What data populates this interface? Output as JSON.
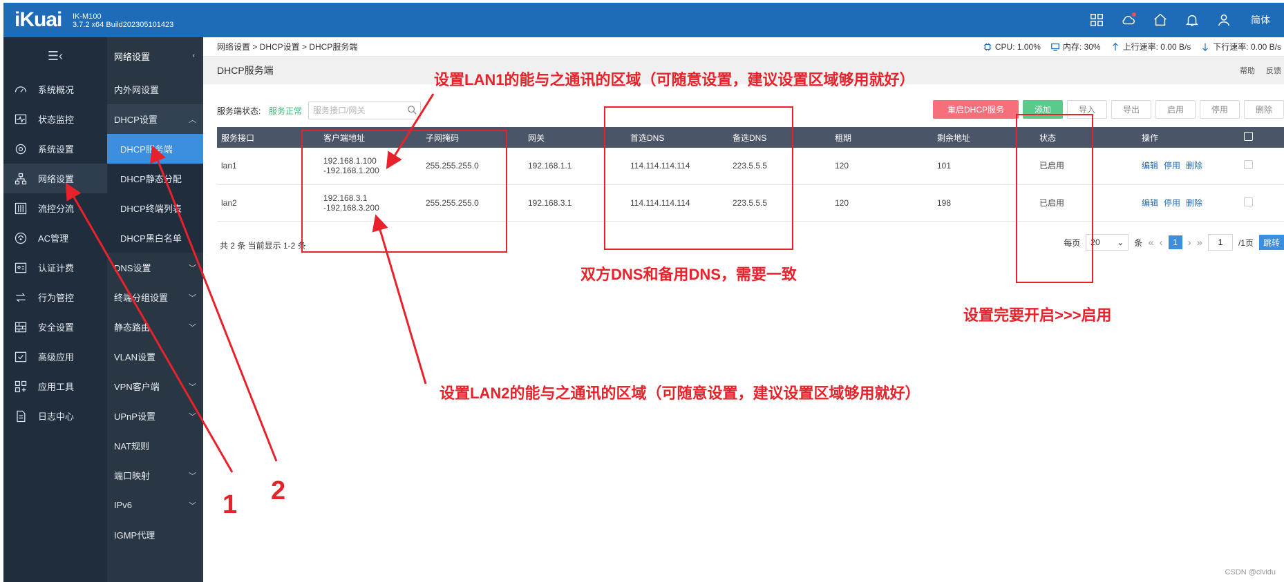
{
  "topbar": {
    "logo": "iKuai",
    "model": "IK-M100",
    "build": "3.7.2 x64 Build202305101423",
    "lang": "简体",
    "icons": [
      "apps-icon",
      "cloud-icon",
      "home-icon",
      "bell-icon",
      "user-icon"
    ]
  },
  "nav1": {
    "items": [
      {
        "label": "系统概况",
        "icon": "dashboard-icon"
      },
      {
        "label": "状态监控",
        "icon": "monitor-icon"
      },
      {
        "label": "系统设置",
        "icon": "gear-icon"
      },
      {
        "label": "网络设置",
        "icon": "network-icon"
      },
      {
        "label": "流控分流",
        "icon": "sliders-icon"
      },
      {
        "label": "AC管理",
        "icon": "wifi-icon"
      },
      {
        "label": "认证计费",
        "icon": "id-card-icon"
      },
      {
        "label": "行为管控",
        "icon": "arrows-icon"
      },
      {
        "label": "安全设置",
        "icon": "firewall-icon"
      },
      {
        "label": "高级应用",
        "icon": "check-square-icon"
      },
      {
        "label": "应用工具",
        "icon": "grid-plus-icon"
      },
      {
        "label": "日志中心",
        "icon": "document-icon"
      }
    ]
  },
  "nav2": {
    "title": "网络设置",
    "items": [
      {
        "label": "内外网设置"
      },
      {
        "label": "DHCP设置"
      },
      {
        "label": "DHCP服务端"
      },
      {
        "label": "DHCP静态分配"
      },
      {
        "label": "DHCP终端列表"
      },
      {
        "label": "DHCP黑白名单"
      },
      {
        "label": "DNS设置"
      },
      {
        "label": "终端分组设置"
      },
      {
        "label": "静态路由"
      },
      {
        "label": "VLAN设置"
      },
      {
        "label": "VPN客户端"
      },
      {
        "label": "UPnP设置"
      },
      {
        "label": "NAT规则"
      },
      {
        "label": "端口映射"
      },
      {
        "label": "IPv6"
      },
      {
        "label": "IGMP代理"
      }
    ]
  },
  "breadcrumb": "网络设置 > DHCP设置 > DHCP服务端",
  "stats": {
    "cpu": "CPU: 1.00%",
    "mem": "内存: 30%",
    "up": "上行速率: 0.00 B/s",
    "down": "下行速率: 0.00 B/s"
  },
  "page": {
    "title": "DHCP服务端",
    "help": "帮助",
    "feedback": "反馈"
  },
  "toolbar": {
    "status_label": "服务端状态:",
    "status_value": "服务正常",
    "search_placeholder": "服务接口/网关",
    "restart": "重启DHCP服务",
    "add": "添加",
    "import": "导入",
    "export": "导出",
    "enable": "启用",
    "disable": "停用",
    "delete": "删除"
  },
  "table": {
    "headers": [
      "服务接口",
      "客户端地址",
      "子网掩码",
      "网关",
      "首选DNS",
      "备选DNS",
      "租期",
      "剩余地址",
      "状态",
      "操作"
    ],
    "rows": [
      {
        "iface": "lan1",
        "range1": "192.168.1.100",
        "range2": "-192.168.1.200",
        "mask": "255.255.255.0",
        "gw": "192.168.1.1",
        "dns1": "114.114.114.114",
        "dns2": "223.5.5.5",
        "lease": "120",
        "remain": "101",
        "status": "已启用",
        "edit": "编辑",
        "stop": "停用",
        "del": "删除"
      },
      {
        "iface": "lan2",
        "range1": "192.168.3.1",
        "range2": "-192.168.3.200",
        "mask": "255.255.255.0",
        "gw": "192.168.3.1",
        "dns1": "114.114.114.114",
        "dns2": "223.5.5.5",
        "lease": "120",
        "remain": "198",
        "status": "已启用",
        "edit": "编辑",
        "stop": "停用",
        "del": "删除"
      }
    ]
  },
  "footer": {
    "summary": "共 2 条 当前显示 1-2 条",
    "per_page": "每页",
    "page_size": "20",
    "unit": "条",
    "current_page": "1",
    "page_input": "1",
    "total_pages": "/1页",
    "jump": "跳转"
  },
  "annotations": {
    "lan1": "设置LAN1的能与之通讯的区域（可随意设置，建议设置区域够用就好）",
    "lan2": "设置LAN2的能与之通讯的区域（可随意设置，建议设置区域够用就好）",
    "dns": "双方DNS和备用DNS，需要一致",
    "enable": "设置完要开启>>>启用",
    "num1": "1",
    "num2": "2"
  },
  "watermark": "CSDN @cividu",
  "colors": {
    "topbar": "#1e6bb8",
    "nav": "#1f2d3d",
    "accent": "#3b8fde",
    "annotation": "#e8222a",
    "ok": "#3dbb79"
  }
}
